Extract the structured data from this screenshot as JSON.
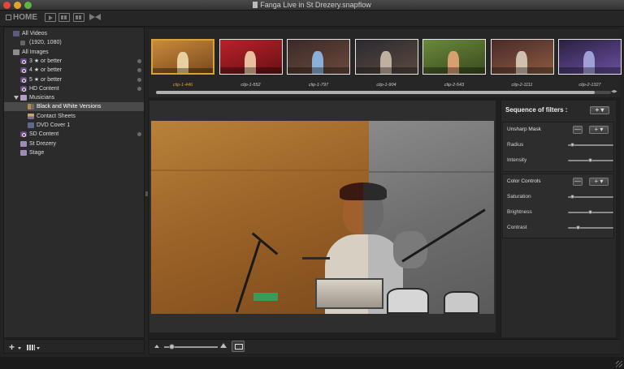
{
  "window": {
    "title": "Fanga Live in St Drezery.snapflow"
  },
  "toolbar": {
    "home_label": "HOME",
    "buttons": [
      "play-icon",
      "grid-icon",
      "magnify-icon",
      "bowtie-icon"
    ]
  },
  "sidebar": {
    "items": [
      {
        "label": "All Videos",
        "icon": "video-icon",
        "indent": 0
      },
      {
        "label": "(1920, 1080)",
        "icon": "resolution-icon",
        "indent": 1
      },
      {
        "label": "All Images",
        "icon": "images-icon",
        "indent": 0
      },
      {
        "label": "3 ★ or better",
        "icon": "smart-album-icon",
        "indent": 1,
        "gear": true
      },
      {
        "label": "4 ★ or better",
        "icon": "smart-album-icon",
        "indent": 1,
        "gear": true
      },
      {
        "label": "5 ★ or better",
        "icon": "smart-album-icon",
        "indent": 1,
        "gear": true
      },
      {
        "label": "HD Content",
        "icon": "smart-album-icon",
        "indent": 1,
        "gear": true
      },
      {
        "label": "Musicians",
        "icon": "folder-icon",
        "indent": 1,
        "expanded": true
      },
      {
        "label": "Black and White Versions",
        "icon": "bw-icon",
        "indent": 2,
        "selected": true
      },
      {
        "label": "Contact Sheets",
        "icon": "contact-sheet-icon",
        "indent": 2
      },
      {
        "label": "DVD Cover 1",
        "icon": "dvd-icon",
        "indent": 2
      },
      {
        "label": "SD Content",
        "icon": "smart-album-icon",
        "indent": 1,
        "gear": true
      },
      {
        "label": "St Drezery",
        "icon": "album-icon",
        "indent": 1
      },
      {
        "label": "Stage",
        "icon": "album-icon",
        "indent": 1
      }
    ]
  },
  "filmstrip": {
    "clips": [
      {
        "label": "clip-1-446",
        "selected": true
      },
      {
        "label": "clip-1-552",
        "selected": false
      },
      {
        "label": "clip-1-797",
        "selected": false
      },
      {
        "label": "clip-1-904",
        "selected": false
      },
      {
        "label": "clip-2-543",
        "selected": false
      },
      {
        "label": "clip-2-1111",
        "selected": false
      },
      {
        "label": "clip-2-1327",
        "selected": false
      }
    ]
  },
  "filters": {
    "header": "Sequence of filters :",
    "sections": [
      {
        "title": "Unsharp Mask",
        "params": [
          {
            "label": "Radius",
            "value": 0.05
          },
          {
            "label": "Intensity",
            "value": 0.5
          }
        ]
      },
      {
        "title": "Color Controls",
        "params": [
          {
            "label": "Saturation",
            "value": 0.05
          },
          {
            "label": "Brightness",
            "value": 0.5
          },
          {
            "label": "Contrast",
            "value": 0.2
          }
        ]
      }
    ]
  },
  "zoom": {
    "level": 0.1
  },
  "colors": {
    "accent_selected": "#d8a23a",
    "background": "#232323"
  }
}
